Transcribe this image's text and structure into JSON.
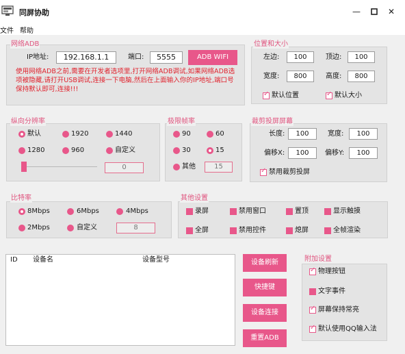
{
  "window": {
    "title": "同屏协助",
    "controls": [
      "minimize-icon",
      "maximize-icon",
      "close-icon"
    ]
  },
  "menu": {
    "file": "文件",
    "help": "帮助"
  },
  "network": {
    "title": "网络ADB",
    "ip_label": "IP地址:",
    "ip_value": "192.168.1.1",
    "port_label": "端口:",
    "port_value": "5555",
    "wifi_button": "ADB WIFI",
    "notice": "使用网络ADB之前,需要在开发者选项里,打开网络ADB调试,如果网络ADB选项被隐藏,请打开USB调试,连接一下电脑,然后在上面输入你的IP地址,端口号保持默认即可,连接!!!"
  },
  "position": {
    "title": "位置和大小",
    "left_label": "左边:",
    "left_value": "100",
    "top_label": "顶边:",
    "top_value": "100",
    "width_label": "宽度:",
    "width_value": "800",
    "height_label": "高度:",
    "height_value": "800",
    "default_pos": "默认位置",
    "default_pos_checked": true,
    "default_size": "默认大小",
    "default_size_checked": true
  },
  "resolution": {
    "title": "纵向分辨率",
    "options": [
      "默认",
      "1920",
      "1440",
      "1280",
      "960",
      "自定义"
    ],
    "selected": "默认",
    "custom_value": "0",
    "slider_level": 0
  },
  "framerate": {
    "title": "极限帧率",
    "options": [
      "90",
      "60",
      "30",
      "15",
      "其他"
    ],
    "selected": "15",
    "custom_value": "15"
  },
  "crop": {
    "title": "裁剪投屏屏幕",
    "length_label": "长度:",
    "length_value": "100",
    "width_label": "宽度:",
    "width_value": "100",
    "offset_x_label": "偏移X:",
    "offset_x_value": "100",
    "offset_y_label": "偏移Y:",
    "offset_y_value": "100",
    "disable_crop": "禁用裁剪投屏",
    "disable_crop_checked": true
  },
  "bitrate": {
    "title": "比特率",
    "options": [
      "8Mbps",
      "6Mbps",
      "4Mbps",
      "2Mbps",
      "自定义"
    ],
    "selected": "8Mbps",
    "custom_value": "8"
  },
  "other": {
    "title": "其他设置",
    "items": [
      "录屏",
      "禁用窗口",
      "置顶",
      "显示触摸",
      "全屏",
      "禁用控件",
      "熄屏",
      "全帧渲染"
    ]
  },
  "devices": {
    "columns": [
      "ID",
      "设备名",
      "设备型号"
    ],
    "rows": []
  },
  "actions": [
    "设备刷新",
    "快捷键",
    "设备连接",
    "重置ADB"
  ],
  "extra": {
    "title": "附加设置",
    "items": [
      {
        "label": "物理按钮",
        "checked": true
      },
      {
        "label": "文字事件",
        "checked": false
      },
      {
        "label": "屏幕保持常亮",
        "checked": true
      },
      {
        "label": "默认使用QQ输入法",
        "checked": true
      }
    ]
  },
  "colors": {
    "accent": "#e8578a",
    "warning": "#e0232e",
    "title": "#e0557f"
  }
}
